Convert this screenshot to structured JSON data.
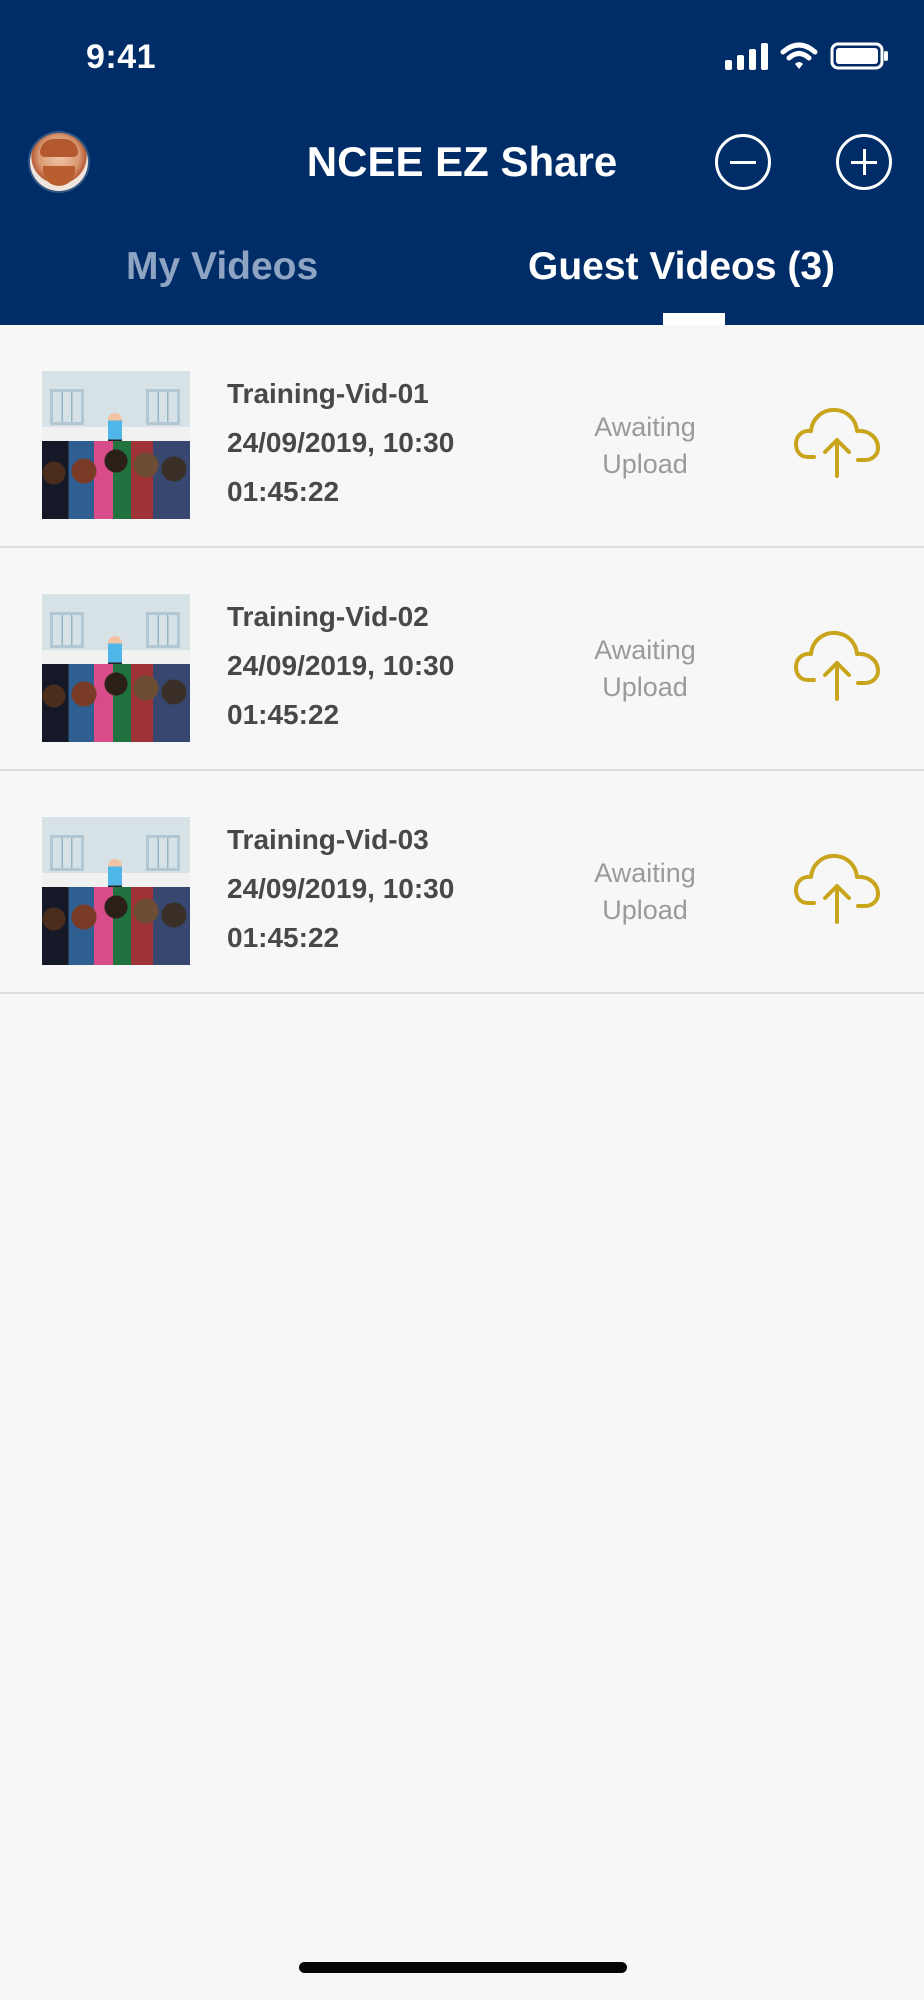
{
  "status_bar": {
    "time": "9:41",
    "icons": [
      "signal-icon",
      "wifi-icon",
      "battery-icon"
    ]
  },
  "header": {
    "title": "NCEE EZ Share",
    "background_color": "#002d67",
    "actions": [
      {
        "name": "minus-circle-icon"
      },
      {
        "name": "plus-circle-icon"
      }
    ]
  },
  "tabs": [
    {
      "label": "My Videos",
      "active": false
    },
    {
      "label": "Guest Videos (3)",
      "active": true
    }
  ],
  "videos": [
    {
      "title": "Training-Vid-01",
      "date": "24/09/2019, 10:30",
      "duration": "01:45:22",
      "status": "Awaiting Upload",
      "icon": "cloud-upload-icon"
    },
    {
      "title": "Training-Vid-02",
      "date": "24/09/2019, 10:30",
      "duration": "01:45:22",
      "status": "Awaiting Upload",
      "icon": "cloud-upload-icon"
    },
    {
      "title": "Training-Vid-03",
      "date": "24/09/2019, 10:30",
      "duration": "01:45:22",
      "status": "Awaiting Upload",
      "icon": "cloud-upload-icon"
    }
  ],
  "colors": {
    "accent": "#c9a51d",
    "list_background": "#f7f7f7",
    "status_text": "#9a9a9a"
  }
}
